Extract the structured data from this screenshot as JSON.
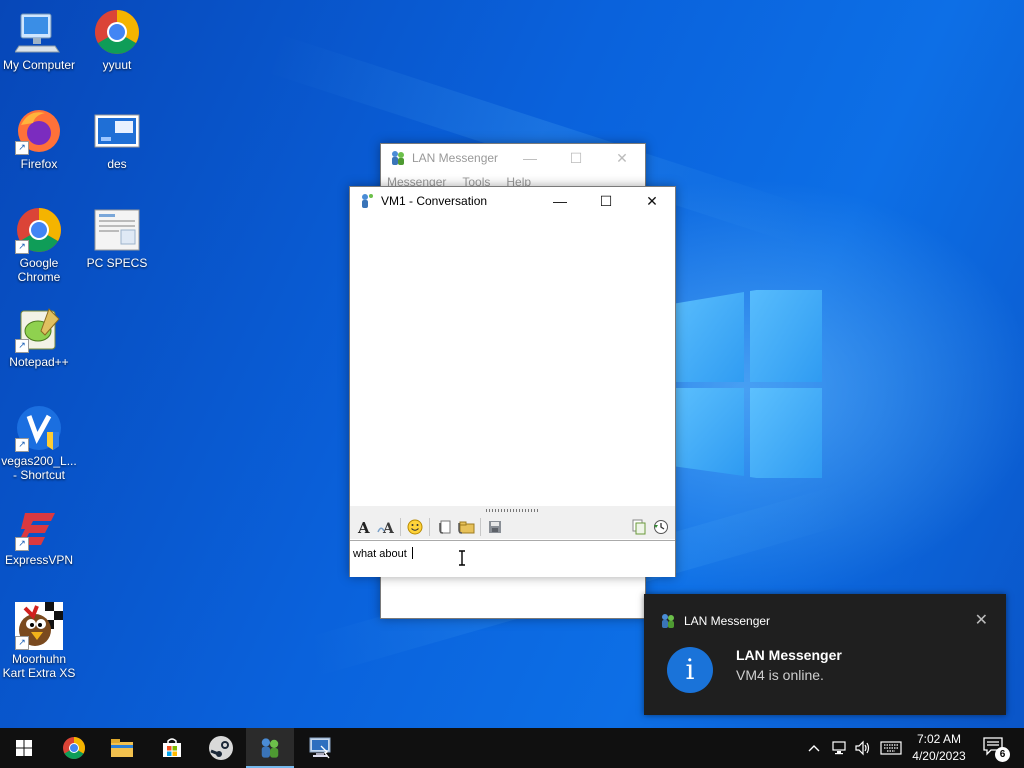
{
  "desktop": {
    "icons": [
      {
        "label": "My Computer"
      },
      {
        "label": "yyuut"
      },
      {
        "label": "Firefox"
      },
      {
        "label": "des"
      },
      {
        "label": "Google Chrome"
      },
      {
        "label": "PC SPECS"
      },
      {
        "label": "Notepad++"
      },
      {
        "label": "vegas200_L... - Shortcut"
      },
      {
        "label": "ExpressVPN"
      },
      {
        "label": "Moorhuhn Kart Extra XS"
      }
    ]
  },
  "main_window": {
    "title": "LAN Messenger",
    "menu": [
      "Messenger",
      "Tools",
      "Help"
    ],
    "minimize": "—",
    "maximize": "☐",
    "close": "✕"
  },
  "conversation": {
    "title": "VM1 - Conversation",
    "minimize": "—",
    "maximize": "☐",
    "close": "✕",
    "input_text": "what about ",
    "toolbar": [
      "font-icon",
      "font-color-icon",
      "emoticon-icon",
      "send-file-icon",
      "send-folder-icon",
      "save-icon",
      "copy-icon",
      "history-icon"
    ]
  },
  "toast": {
    "app_name": "LAN Messenger",
    "title": "LAN Messenger",
    "message": "VM4 is online.",
    "close": "✕",
    "info_glyph": "i"
  },
  "taskbar": {
    "time": "7:02 AM",
    "date": "4/20/2023",
    "notification_count": "6",
    "accent": "#76b9ed"
  }
}
